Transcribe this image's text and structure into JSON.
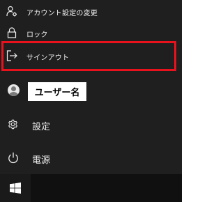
{
  "menu": {
    "account_settings": "アカウント設定の変更",
    "lock": "ロック",
    "sign_out": "サインアウト",
    "username": "ユーザー名",
    "settings": "設定",
    "power": "電源"
  },
  "colors": {
    "panel_bg": "#1f1f1f",
    "taskbar_bg": "#101010",
    "text": "#f0f0f0",
    "highlight_border": "#e8121c"
  },
  "icons": {
    "account_settings": "person-gear-icon",
    "lock": "lock-icon",
    "sign_out": "sign-out-icon",
    "user": "user-avatar-icon",
    "settings": "gear-icon",
    "power": "power-icon",
    "start": "windows-logo-icon"
  }
}
